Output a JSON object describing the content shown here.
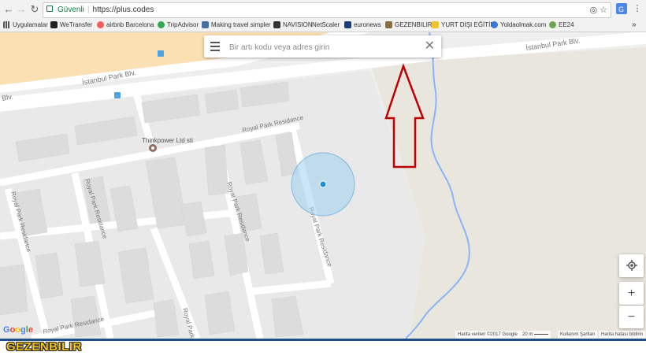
{
  "browser": {
    "omnibox": {
      "secure_label": "Güvenli",
      "url": "https://plus.codes"
    },
    "bookmarks": [
      {
        "label": "Uygulamalar",
        "icon": "apps-grid-icon",
        "color": "#555555"
      },
      {
        "label": "WeTransfer",
        "icon": "wetransfer-icon",
        "color": "#222222"
      },
      {
        "label": "airbnb Barcelona",
        "icon": "airbnb-icon",
        "color": "#ff5a5f"
      },
      {
        "label": "TripAdvisor",
        "icon": "tripadvisor-icon",
        "color": "#34a853"
      },
      {
        "label": "Making travel simpler",
        "icon": "page-icon",
        "color": "#4a6fa5"
      },
      {
        "label": "NAVISION",
        "icon": "navision-icon",
        "color": "#333333"
      },
      {
        "label": "NetScaler",
        "icon": "netscaler-icon",
        "color": "#999999"
      },
      {
        "label": "euronews",
        "icon": "euronews-icon",
        "color": "#1a3d7c"
      },
      {
        "label": "GEZENBILIR",
        "icon": "gezenbilir-icon",
        "color": "#8a6d3b"
      },
      {
        "label": "YURT DIŞI EĞİTİM",
        "icon": "folder-icon",
        "color": "#f1c232"
      },
      {
        "label": "Yoldaolmak.com",
        "icon": "yoldaolmak-icon",
        "color": "#3c78d8"
      },
      {
        "label": "EE24",
        "icon": "ee24-icon",
        "color": "#6aa84f"
      }
    ],
    "more_label": "»"
  },
  "map": {
    "search_placeholder": "Bir artı kodu veya adres girin",
    "street_labels": {
      "istanbul_park_left": "İstanbul Park Blv.",
      "istanbul_park_right": "İstanbul Park Blv.",
      "blv_fragment": "Blv.",
      "royal_park_top": "Royal Park Residance",
      "royal_park_v1": "Royal Park Residance",
      "royal_park_v2": "Royal Park Residance",
      "royal_park_v3": "Royal Park Residance",
      "royal_park_v4": "Royal Park Residance",
      "royal_park_left": "Royal Park Residance",
      "royal_park_bottom": "Royal Park Residance",
      "royal_park_bottom_v": "Royal Park"
    },
    "poi_label": "Thinkpower Ltd sti",
    "google_logo": "Google",
    "attribution": {
      "data": "Harita verileri ©2017 Google",
      "scale": "20 m",
      "terms": "Kullanım Şartları",
      "report": "Harita hatası bildirin"
    },
    "zoom_in": "+",
    "zoom_out": "−"
  },
  "watermark": "GEZENBILIR",
  "colors": {
    "road": "#ffffff",
    "building": "#e1e1e1",
    "ground": "#eeeeee",
    "park": "#e8e6dd",
    "highway": "#fbe0b4",
    "river": "#8ab4f8",
    "accuracy": "#9ccfee",
    "location_dot": "#1a8fd8",
    "arrow": "#c00000"
  }
}
